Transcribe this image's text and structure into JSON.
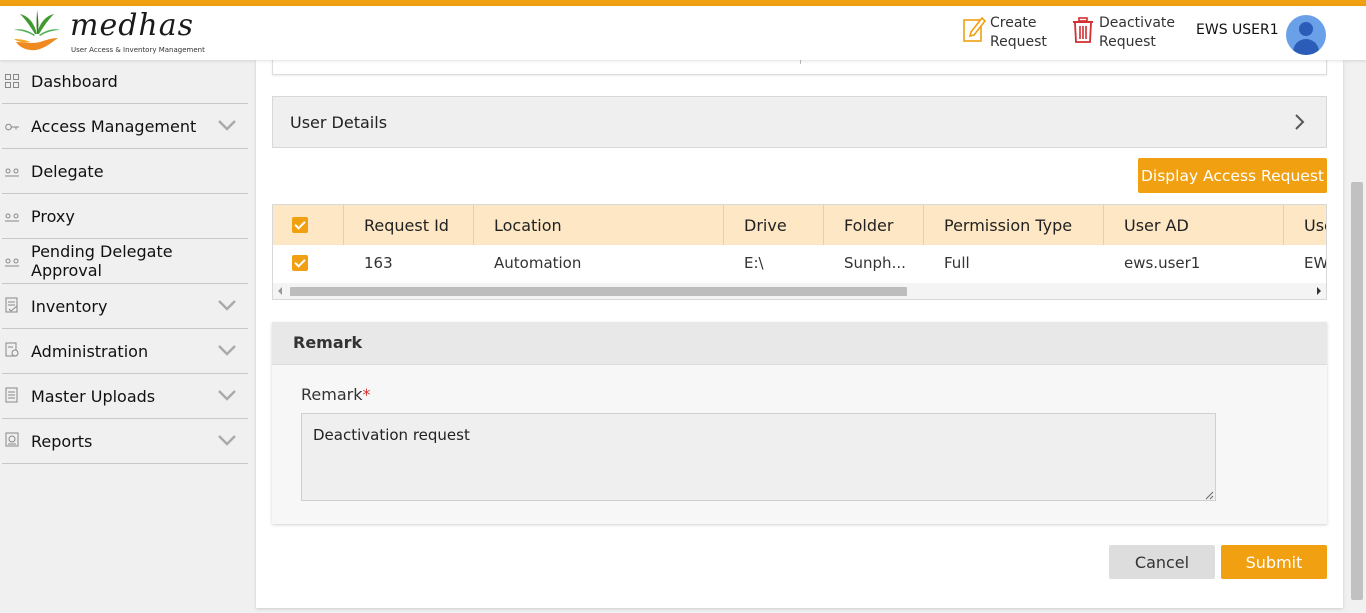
{
  "header": {
    "logo_word": "medhas",
    "logo_subtitle": "User Access & Inventory Management",
    "create_request": [
      "Create",
      "Request"
    ],
    "deactivate_request": [
      "Deactivate",
      "Request"
    ],
    "user_name": "EWS USER1",
    "accent_color": "#f0a010"
  },
  "sidebar": {
    "items": [
      {
        "label": "Dashboard",
        "icon": "grid-icon"
      },
      {
        "label": "Access Management",
        "icon": "key-icon"
      },
      {
        "label": "Delegate",
        "icon": "delegate-icon"
      },
      {
        "label": "Proxy",
        "icon": "proxy-icon"
      },
      {
        "label": "Pending Delegate Approval",
        "icon": "pending-icon"
      },
      {
        "label": "Inventory",
        "icon": "inventory-icon"
      },
      {
        "label": "Administration",
        "icon": "administration-icon"
      },
      {
        "label": "Master Uploads",
        "icon": "upload-icon"
      },
      {
        "label": "Reports",
        "icon": "reports-icon"
      }
    ]
  },
  "main": {
    "user_details_title": "User Details",
    "display_button": "Display Access Request",
    "table": {
      "columns": [
        "Request Id",
        "Location",
        "Drive",
        "Folder",
        "Permission Type",
        "User AD",
        "Use"
      ],
      "rows": [
        {
          "request_id": "163",
          "location": "Automation",
          "drive": "E:\\",
          "folder": "Sunph...",
          "permission_type": "Full",
          "user_ad": "ews.user1",
          "user": "EW"
        }
      ]
    },
    "remark": {
      "title": "Remark",
      "label": "Remark",
      "required_mark": "*",
      "value": "Deactivation request"
    },
    "cancel_button": "Cancel",
    "submit_button": "Submit"
  }
}
